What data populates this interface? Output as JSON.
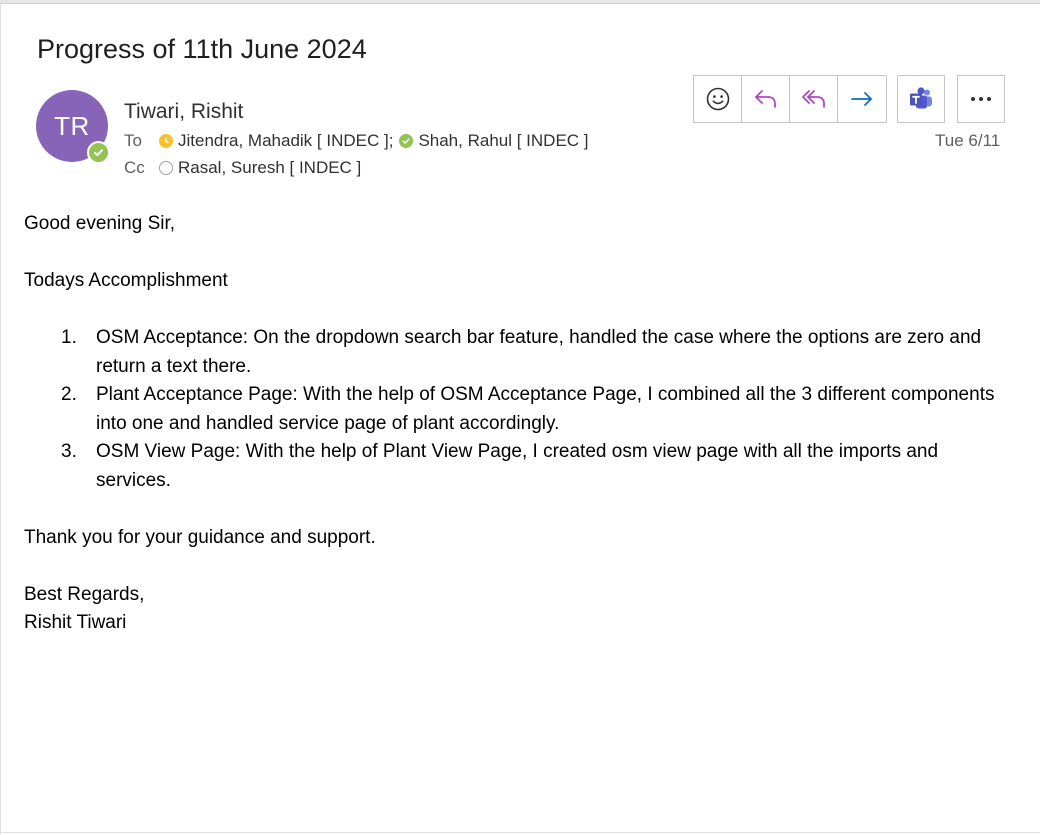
{
  "email": {
    "subject": "Progress of 11th June 2024",
    "sender": {
      "initials": "TR",
      "name": "Tiwari, Rishit",
      "avatar_color": "#8764b8",
      "presence": "available"
    },
    "to_label": "To",
    "cc_label": "Cc",
    "to": [
      {
        "name": "Jitendra, Mahadik [ INDEC ]",
        "presence": "away"
      },
      {
        "name": "Shah, Rahul [ INDEC ]",
        "presence": "available"
      }
    ],
    "to_separator": ";",
    "cc": [
      {
        "name": "Rasal, Suresh [ INDEC ]",
        "presence": "offline"
      }
    ],
    "date": "Tue 6/11",
    "toolbar": {
      "react_icon": "smiley-icon",
      "reply_icon": "reply-icon",
      "reply_all_icon": "reply-all-icon",
      "forward_icon": "forward-icon",
      "teams_icon": "teams-icon",
      "more_icon": "more-icon"
    },
    "body": {
      "greeting": "Good evening Sir,",
      "heading": "Todays Accomplishment",
      "items": [
        {
          "num": "1.",
          "text": "OSM Acceptance: On the dropdown search bar feature, handled the case where the options are zero and return a text there."
        },
        {
          "num": "2.",
          "text": "Plant Acceptance Page: With the help of OSM Acceptance Page, I combined all the 3 different components into one and handled service page of plant accordingly."
        },
        {
          "num": "3.",
          "text": "OSM View Page: With the help of Plant View Page, I created osm view page with all the imports and services."
        }
      ],
      "thanks": "Thank you for your guidance and support.",
      "closing": "Best Regards,",
      "signature": "Rishit Tiwari"
    }
  },
  "colors": {
    "accent_purple": "#8764b8",
    "reply_purple": "#b146c2",
    "forward_blue": "#0f6cbd",
    "available_green": "#92c353",
    "away_yellow": "#f8c12c"
  }
}
